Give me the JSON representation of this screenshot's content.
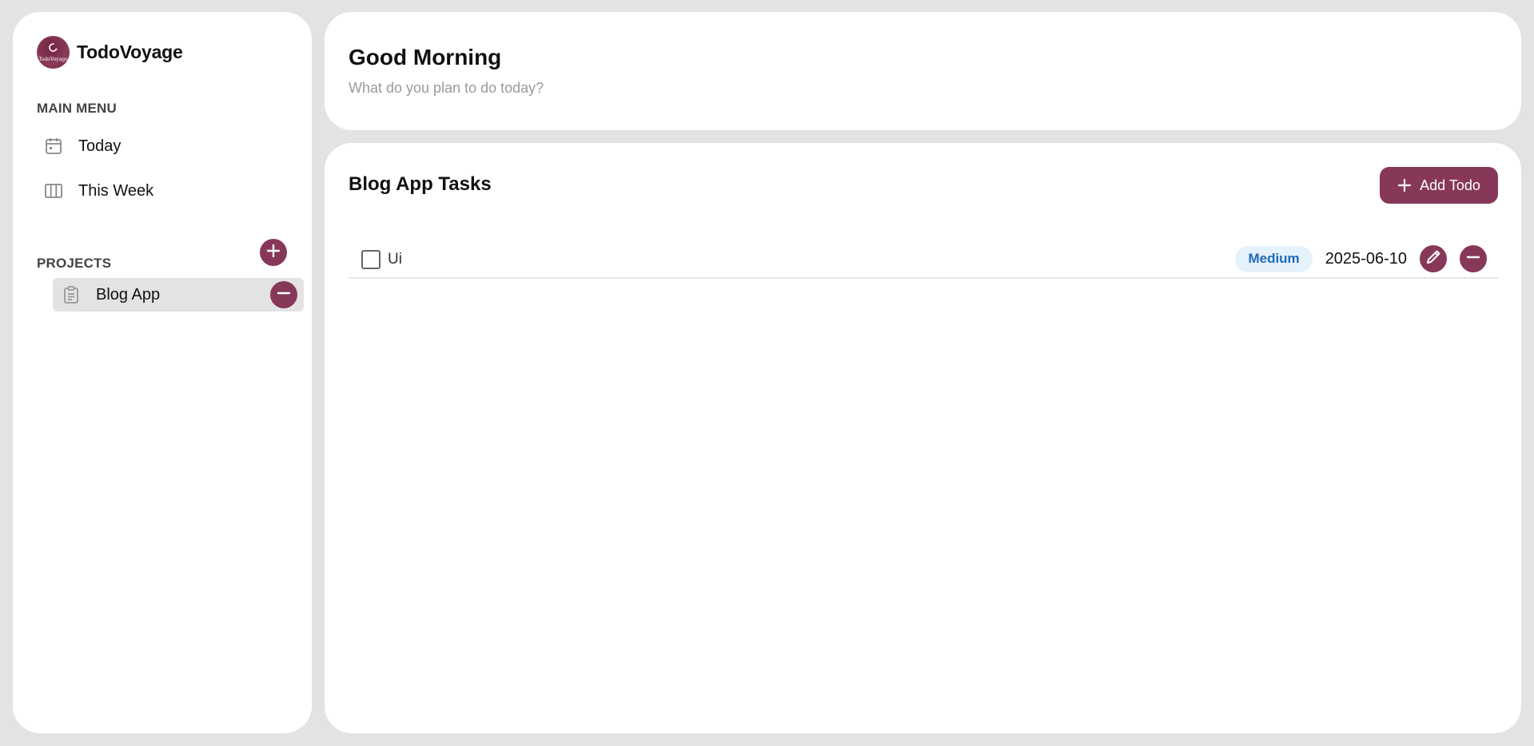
{
  "brand": {
    "name": "TodoVoyage",
    "logo_text": "TodoVoyage"
  },
  "sidebar": {
    "main_menu_label": "MAIN MENU",
    "items": [
      {
        "label": "Today",
        "icon": "calendar-icon"
      },
      {
        "label": "This Week",
        "icon": "columns-icon"
      }
    ],
    "projects_label": "PROJECTS",
    "projects": [
      {
        "label": "Blog App",
        "icon": "clipboard-icon"
      }
    ]
  },
  "header": {
    "greeting": "Good Morning",
    "subtitle": "What do you plan to do today?"
  },
  "main": {
    "title": "Blog App Tasks",
    "add_label": "Add Todo",
    "todos": [
      {
        "text": "Ui",
        "done": false,
        "priority": "Medium",
        "due": "2025-06-10"
      }
    ]
  },
  "colors": {
    "accent": "#873859",
    "priority_bg": "#e5f1fb",
    "priority_text": "#1e6bb8",
    "page_bg": "#e3e3e3"
  }
}
